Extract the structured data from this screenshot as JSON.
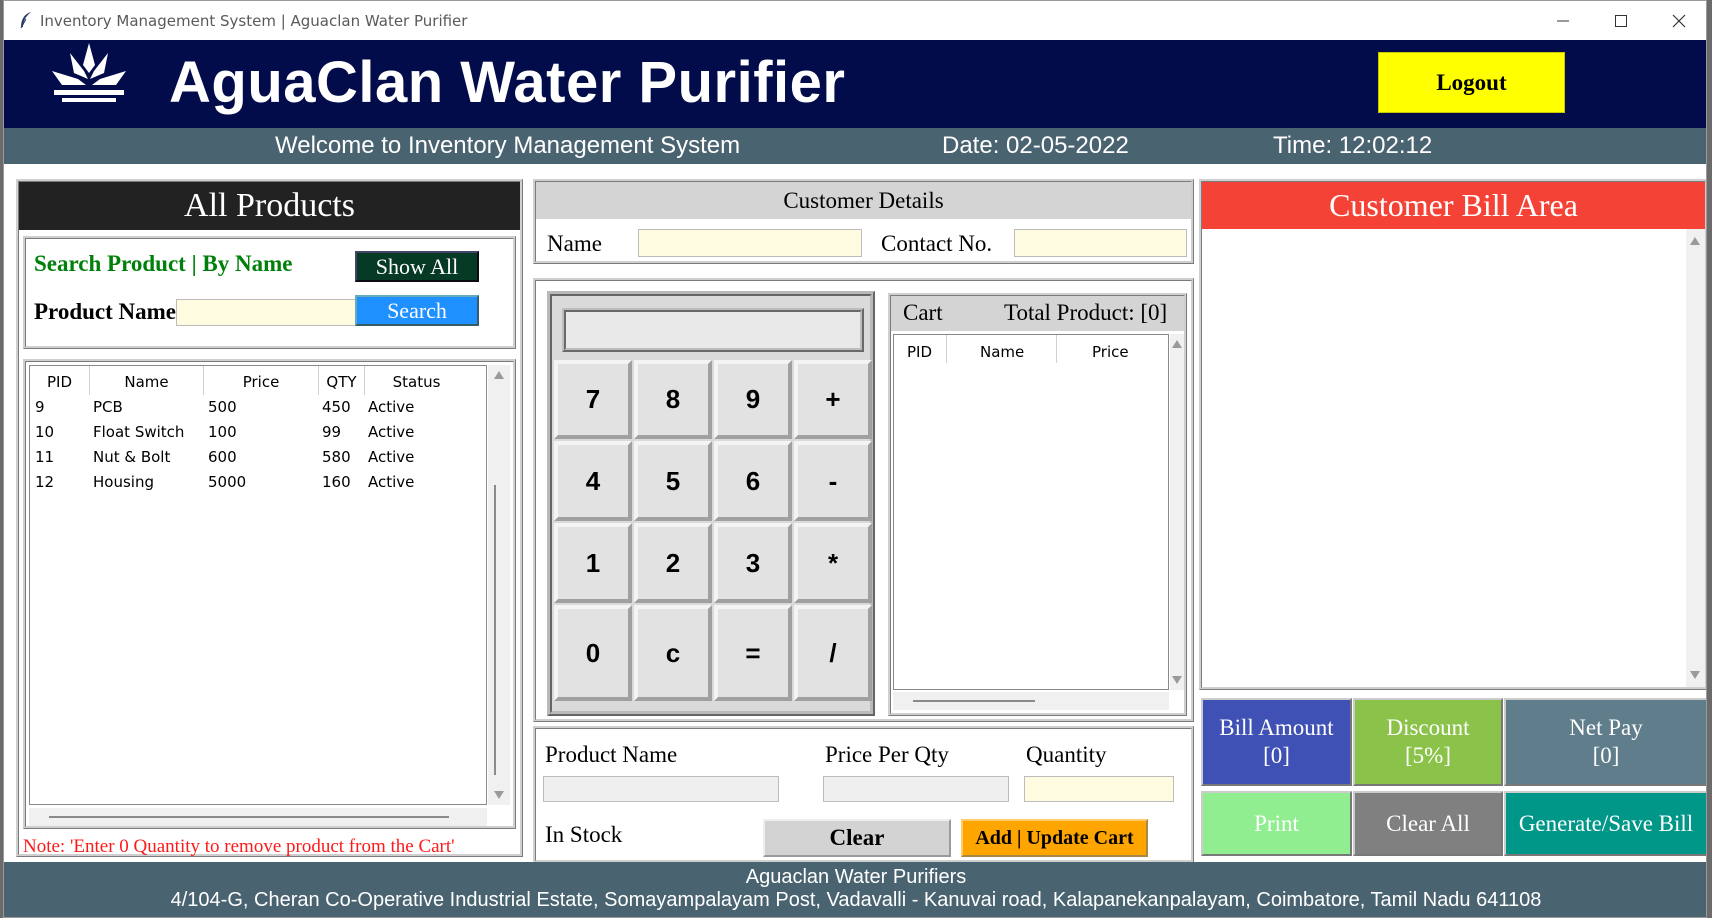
{
  "window": {
    "title": "Inventory Management System | Aguaclan Water Purifier"
  },
  "header": {
    "app_title": "AguaClan Water Purifier",
    "logout_label": "Logout",
    "welcome": "Welcome to Inventory Management System",
    "date": "Date: 02-05-2022",
    "time": "Time: 12:02:12"
  },
  "products_panel": {
    "title": "All Products",
    "search_title": "Search Product | By Name",
    "show_all_label": "Show All",
    "product_name_label": "Product Name",
    "product_name_value": "",
    "search_label": "Search",
    "columns": [
      "PID",
      "Name",
      "Price",
      "QTY",
      "Status"
    ],
    "rows": [
      {
        "pid": "9",
        "name": "PCB",
        "price": "500",
        "qty": "450",
        "status": "Active"
      },
      {
        "pid": "10",
        "name": "Float Switch",
        "price": "100",
        "qty": "99",
        "status": "Active"
      },
      {
        "pid": "11",
        "name": "Nut & Bolt",
        "price": "600",
        "qty": "580",
        "status": "Active"
      },
      {
        "pid": "12",
        "name": "Housing",
        "price": "5000",
        "qty": "160",
        "status": "Active"
      }
    ],
    "note": "Note: 'Enter 0 Quantity to remove product from the Cart'"
  },
  "customer": {
    "title": "Customer Details",
    "name_label": "Name",
    "name_value": "",
    "contact_label": "Contact No.",
    "contact_value": ""
  },
  "calculator": {
    "display": "",
    "keys": [
      "7",
      "8",
      "9",
      "+",
      "4",
      "5",
      "6",
      "-",
      "1",
      "2",
      "3",
      "*",
      "0",
      "c",
      "=",
      "/"
    ]
  },
  "cart": {
    "title": "Cart",
    "total_label": "Total Product: [0]",
    "columns": [
      "PID",
      "Name",
      "Price"
    ]
  },
  "entry": {
    "product_name_label": "Product Name",
    "price_label": "Price Per Qty",
    "quantity_label": "Quantity",
    "in_stock_label": "In Stock",
    "clear_label": "Clear",
    "add_label": "Add | Update Cart"
  },
  "bill": {
    "title": "Customer Bill Area",
    "bill_amount_label": "Bill Amount",
    "bill_amount_value": "[0]",
    "discount_label": "Discount",
    "discount_value": "[5%]",
    "net_pay_label": "Net Pay",
    "net_pay_value": "[0]",
    "print_label": "Print",
    "clear_all_label": "Clear All",
    "generate_label": "Generate/Save Bill"
  },
  "footer": {
    "line1": "Aguaclan Water Purifiers",
    "line2": "4/104-G, Cheran Co-Operative Industrial Estate, Somayampalayam Post, Vadavalli - Kanuvai road, Kalapanekanpalayam, Coimbatore, Tamil Nadu 641108"
  },
  "colors": {
    "header_bg": "#020c4a",
    "subbar_bg": "#4a6370",
    "logout_bg": "#ffff00",
    "bill_head": "#f44336",
    "bill_amount_bg": "#3f51b5",
    "discount_bg": "#8bc34a",
    "net_pay_bg": "#607d8b",
    "print_bg": "#90ee90",
    "clear_all_bg": "#808080",
    "generate_bg": "#009688"
  }
}
